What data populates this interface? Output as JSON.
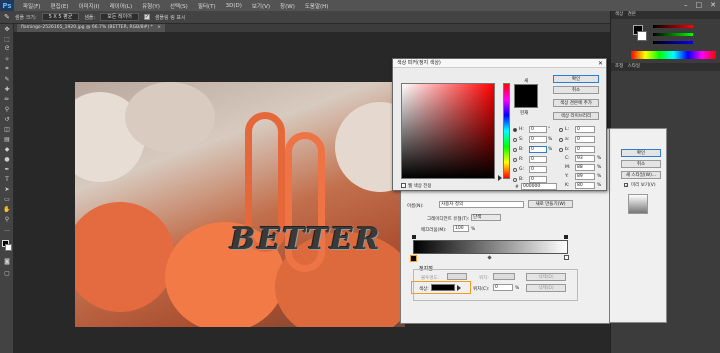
{
  "app": {
    "logo": "Ps"
  },
  "menu": {
    "items": [
      "파일(F)",
      "편집(E)",
      "이미지(I)",
      "레이어(L)",
      "유형(Y)",
      "선택(S)",
      "필터(T)",
      "3D(D)",
      "보기(V)",
      "창(W)",
      "도움말(H)"
    ]
  },
  "window_controls": {
    "minimize": "–",
    "maximize": "□",
    "close": "✕"
  },
  "options_bar": {
    "sample_size_label": "샘플 크기:",
    "sample_size_value": "5 X 5 평균",
    "sample_label": "샘플:",
    "sample_value": "모든 레이어",
    "ring_label": "샘플링 링 표시"
  },
  "document_tab": {
    "title": "flamingo-2526165_1920.jpg @ 66.7% (BETTER, RGB/8#) *",
    "close": "×"
  },
  "canvas_text": "BETTER",
  "color_picker": {
    "title": "색상 피커(정지 색상)",
    "ok": "확인",
    "cancel": "취소",
    "add_swatch": "색상 견본에 추가",
    "libraries": "색상 라이브러리",
    "new_label": "새",
    "current_label": "현재",
    "web_only": "웹 색상 전용",
    "H": {
      "label": "H:",
      "value": "0",
      "unit": "°"
    },
    "S": {
      "label": "S:",
      "value": "0",
      "unit": "%"
    },
    "B": {
      "label": "B:",
      "value": "0",
      "unit": "%"
    },
    "R": {
      "label": "R:",
      "value": "0"
    },
    "G": {
      "label": "G:",
      "value": "0"
    },
    "Bb": {
      "label": "B:",
      "value": "0"
    },
    "L": {
      "label": "L:",
      "value": "0"
    },
    "a": {
      "label": "a:",
      "value": "0"
    },
    "b": {
      "label": "b:",
      "value": "0"
    },
    "C": {
      "label": "C:",
      "value": "93",
      "unit": "%"
    },
    "M": {
      "label": "M:",
      "value": "88",
      "unit": "%"
    },
    "Y": {
      "label": "Y:",
      "value": "89",
      "unit": "%"
    },
    "K": {
      "label": "K:",
      "value": "80",
      "unit": "%"
    },
    "hex_label": "#",
    "hex": "000000",
    "new_color": "#000000",
    "current_color": "#000000"
  },
  "gradient_editor": {
    "name_label": "이름(N):",
    "name_value": "사용자 정의",
    "new_button": "새로 만들기(W)",
    "type_label": "그레이디언트 유형(T):",
    "type_value": "단색",
    "smooth_label": "매끄러움(M):",
    "smooth_value": "100",
    "smooth_unit": "%",
    "stops_title": "정지점",
    "opacity_label": "불투명도:",
    "location_label": "위치:",
    "delete_label": "삭제(D)",
    "color_label": "색상:",
    "color_location_label": "위치(C):",
    "color_location_value": "0",
    "color_unit": "%",
    "stop_color": "#000000"
  },
  "layer_style": {
    "ok": "확인",
    "cancel": "취소",
    "new_style": "새 스타일(W)...",
    "preview": "미리 보기(V)"
  },
  "panels": {
    "color_tab": "색상",
    "swatches_tab": "견본",
    "adjust_tab": "조정",
    "styles_tab": "스타일"
  }
}
